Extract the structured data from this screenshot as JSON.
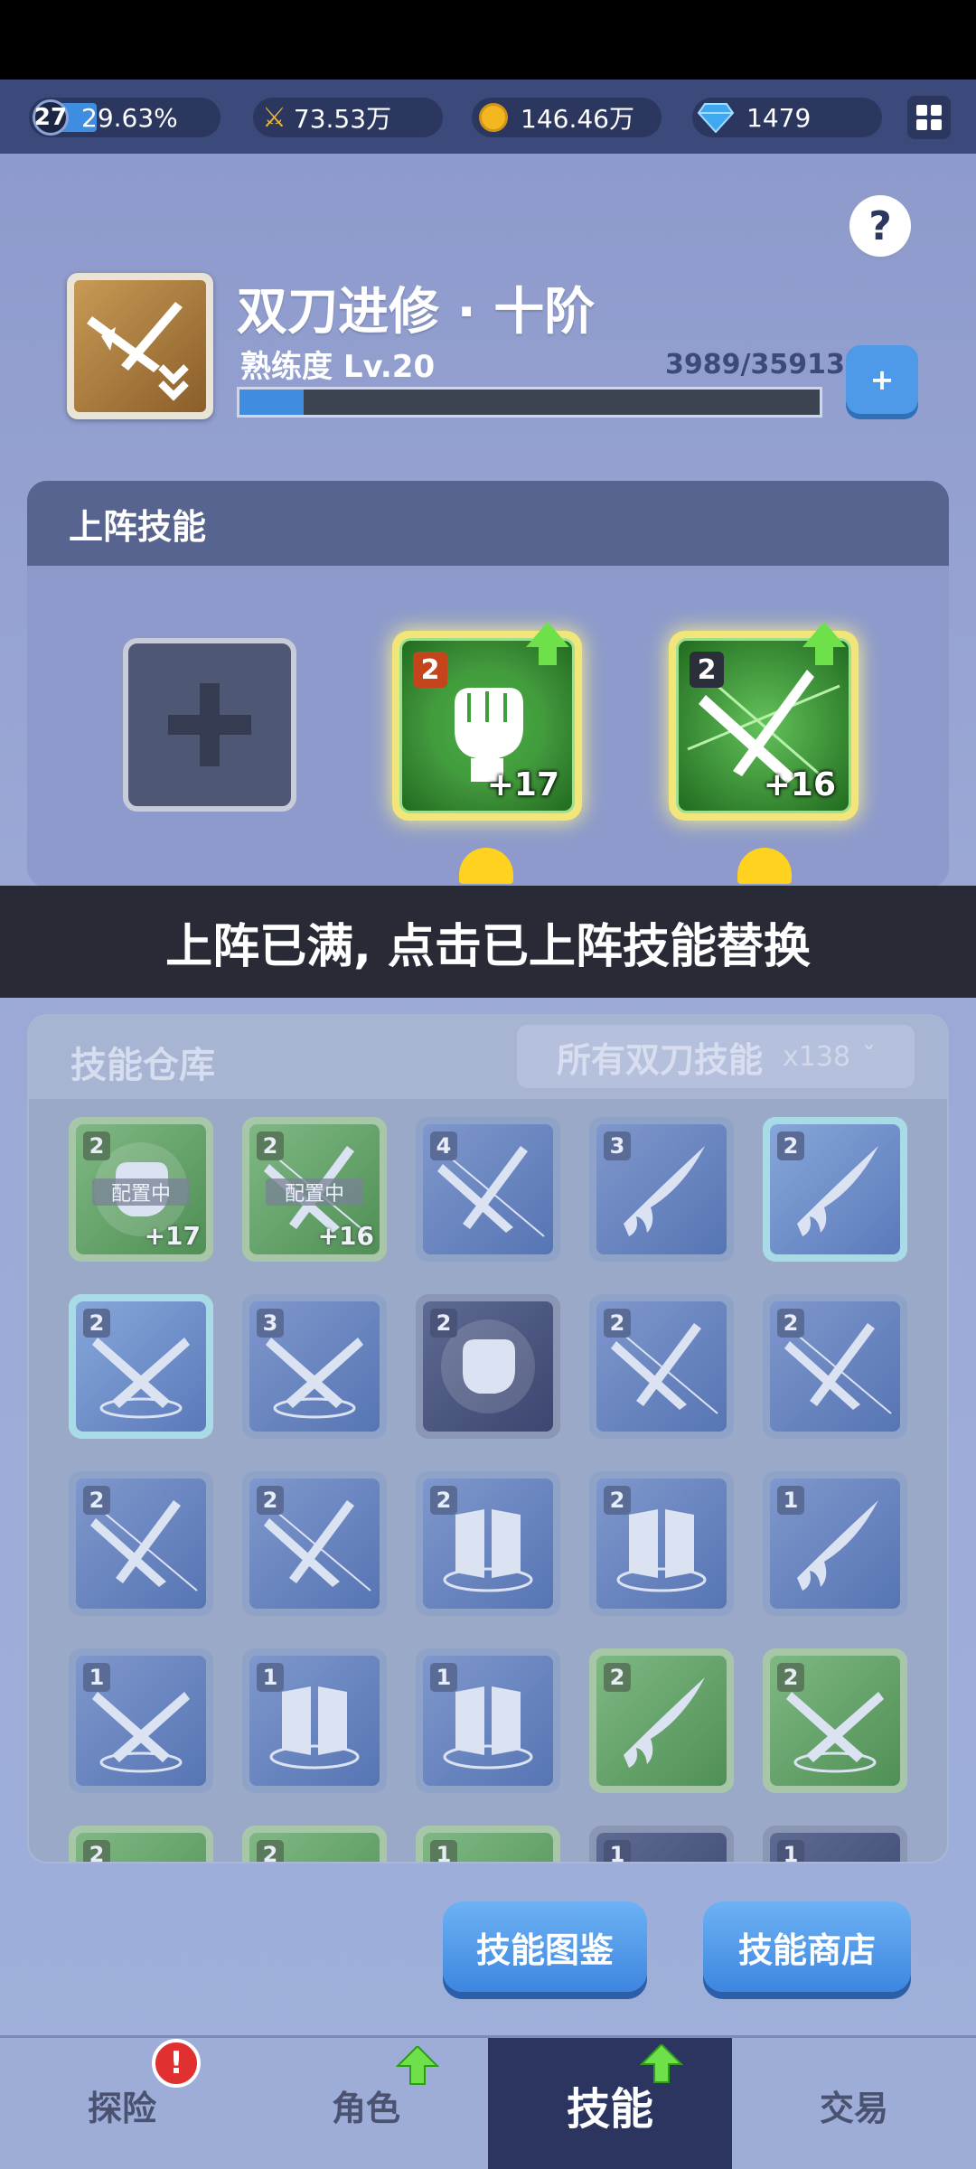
{
  "top_bar": {
    "level": "27",
    "xp_percent": "29.63%",
    "xp_fraction": 0.2963,
    "power": "73.53万",
    "gold": "146.46万",
    "diamonds": "1479",
    "icons": [
      "crossed-swords-icon",
      "gold-coin-icon",
      "diamond-icon",
      "grid-menu-icon"
    ]
  },
  "help_label": "?",
  "skill": {
    "name": "双刀进修 · 十阶",
    "proficiency_label": "熟练度 Lv.20",
    "proficiency_value": "3989/35913",
    "proficiency_fraction": 0.111,
    "add_label": "+"
  },
  "equipped": {
    "title": "上阵技能",
    "slots": [
      {
        "empty": true
      },
      {
        "level": "2",
        "bonus": "+17",
        "icon": "fist-icon"
      },
      {
        "level": "2",
        "bonus": "+16",
        "icon": "dual-blades-icon"
      }
    ]
  },
  "toast": "上阵已满, 点击已上阵技能替换",
  "inventory": {
    "title": "技能仓库",
    "filter_label": "所有双刀技能",
    "filter_count": "x138",
    "filter_caret": "ˇ",
    "config_label": "配置中",
    "items": [
      {
        "level": "2",
        "config": true,
        "bonus": "+17",
        "color": "green",
        "icon": "fist-icon"
      },
      {
        "level": "2",
        "config": true,
        "bonus": "+16",
        "color": "green",
        "icon": "dual-blades-icon"
      },
      {
        "level": "4",
        "color": "blue",
        "icon": "dual-blades-icon"
      },
      {
        "level": "3",
        "color": "blue",
        "icon": "slash-claw-icon"
      },
      {
        "level": "2",
        "color": "teal",
        "icon": "slash-claw-icon"
      },
      {
        "level": "2",
        "color": "teal",
        "icon": "crossed-daggers-icon"
      },
      {
        "level": "3",
        "color": "blue",
        "icon": "crossed-daggers-icon"
      },
      {
        "level": "2",
        "color": "dark",
        "icon": "fist-icon"
      },
      {
        "level": "2",
        "color": "blue",
        "icon": "dual-blades-icon"
      },
      {
        "level": "2",
        "color": "blue",
        "icon": "dual-blades-icon"
      },
      {
        "level": "2",
        "color": "blue",
        "icon": "dual-blades-icon"
      },
      {
        "level": "2",
        "color": "blue",
        "icon": "dual-blades-icon"
      },
      {
        "level": "2",
        "color": "blue",
        "icon": "armor-icon"
      },
      {
        "level": "2",
        "color": "blue",
        "icon": "armor-icon"
      },
      {
        "level": "1",
        "color": "blue",
        "icon": "slash-claw-icon"
      },
      {
        "level": "1",
        "color": "blue",
        "icon": "crossed-daggers-icon"
      },
      {
        "level": "1",
        "color": "blue",
        "icon": "armor-icon"
      },
      {
        "level": "1",
        "color": "blue",
        "icon": "armor-icon"
      },
      {
        "level": "2",
        "color": "green",
        "icon": "slash-claw-icon"
      },
      {
        "level": "2",
        "color": "green",
        "icon": "crossed-daggers-icon"
      },
      {
        "level": "2",
        "color": "green",
        "icon": "skill-icon"
      },
      {
        "level": "2",
        "color": "green",
        "icon": "skill-icon"
      },
      {
        "level": "1",
        "color": "green",
        "icon": "skill-icon"
      },
      {
        "level": "1",
        "color": "dark",
        "icon": "skill-icon"
      },
      {
        "level": "1",
        "color": "dark",
        "icon": "skill-icon"
      }
    ]
  },
  "buttons": {
    "codex": "技能图鉴",
    "shop": "技能商店"
  },
  "nav": {
    "tabs": [
      "探险",
      "角色",
      "技能",
      "交易"
    ],
    "active": "技能",
    "alert": "!"
  }
}
